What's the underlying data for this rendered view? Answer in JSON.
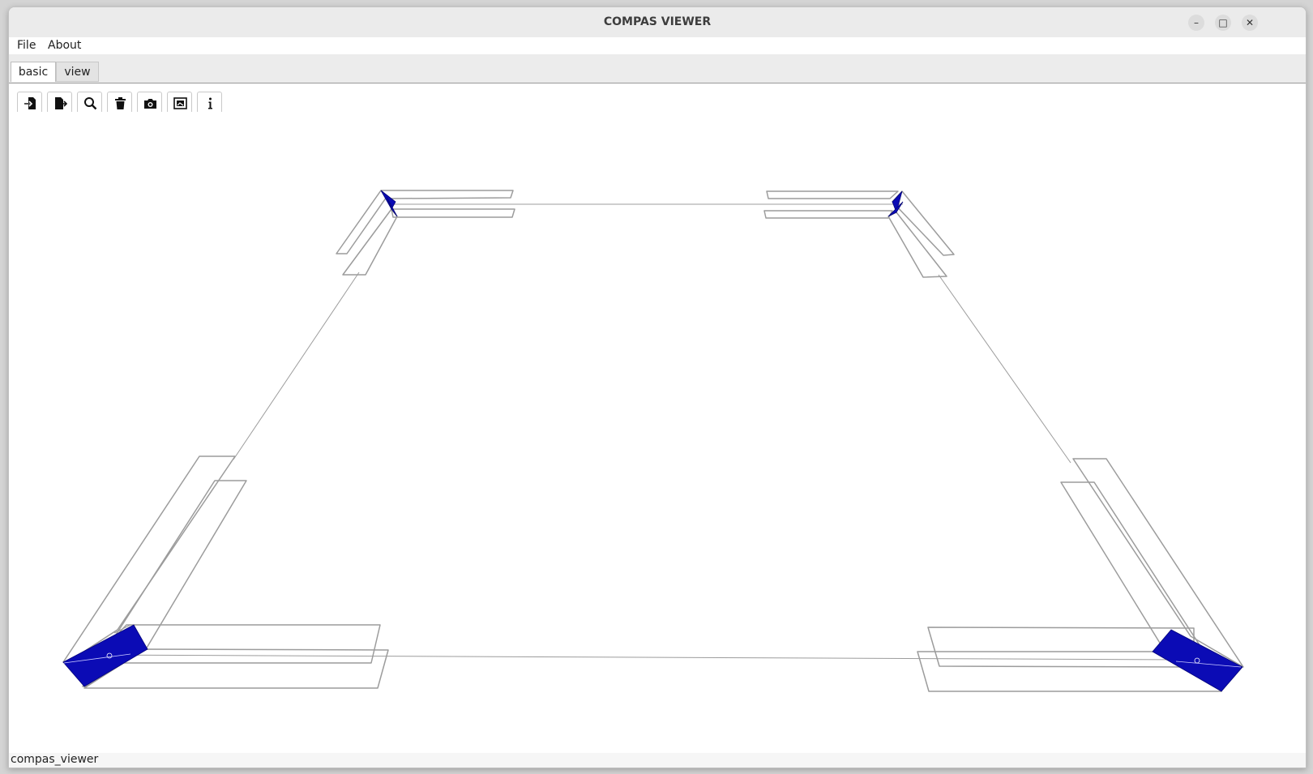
{
  "window": {
    "title": "COMPAS VIEWER"
  },
  "menubar": {
    "items": [
      "File",
      "About"
    ]
  },
  "tabs": [
    {
      "label": "basic",
      "active": true
    },
    {
      "label": "view",
      "active": false
    }
  ],
  "toolbar": {
    "icons": [
      "file-open-icon",
      "file-export-icon",
      "zoom-icon",
      "trash-icon",
      "camera-icon",
      "fit-view-icon",
      "info-icon"
    ]
  },
  "status": {
    "text": "compas_viewer"
  },
  "colors": {
    "accent": "#0b0bb5",
    "wire": "#9c9c9c"
  }
}
